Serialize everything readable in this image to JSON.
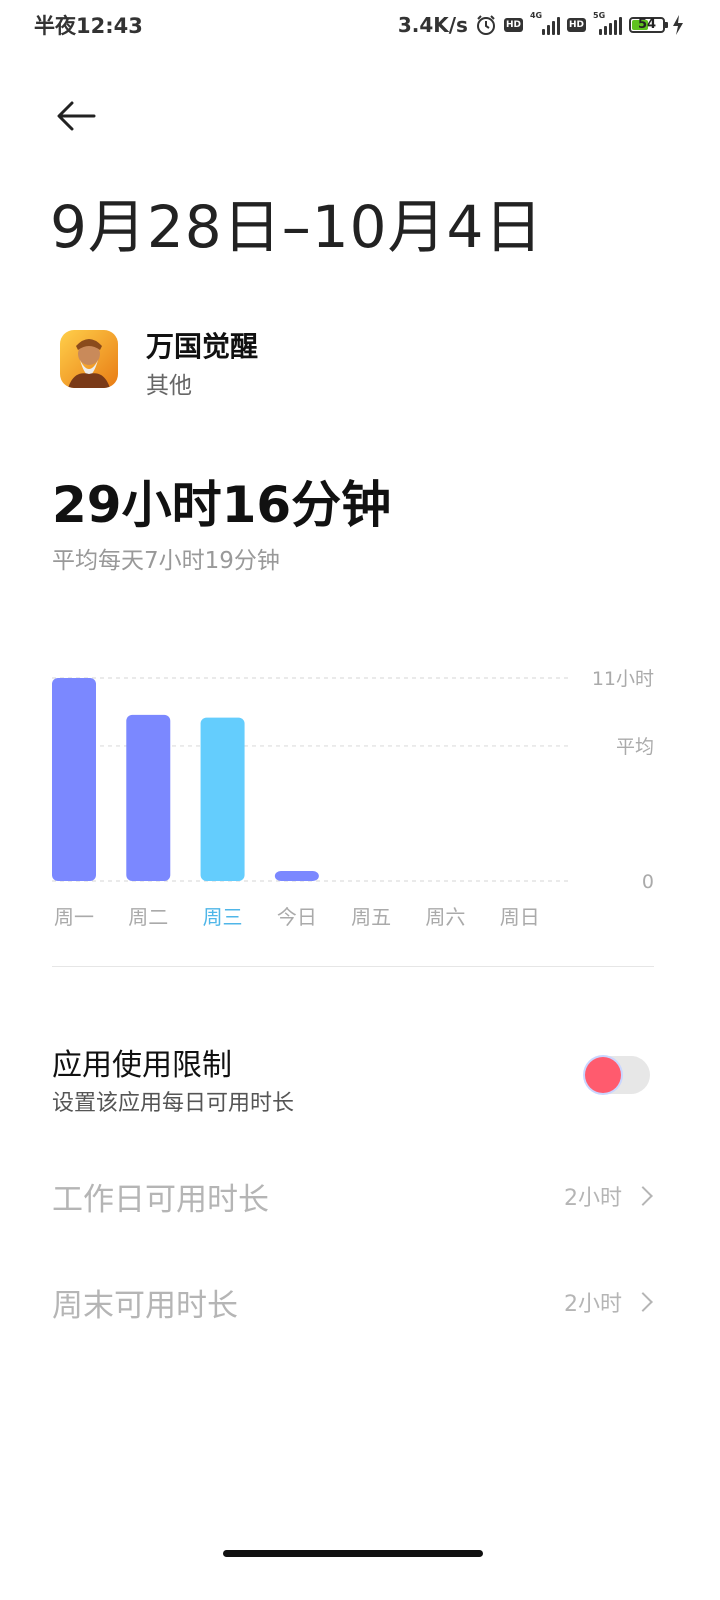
{
  "status_bar": {
    "time": "半夜12:43",
    "net_speed": "3.4K/s",
    "hd1": "HD",
    "net1": "4G",
    "hd2": "HD",
    "net2": "5G",
    "battery": "54",
    "battery_level": 0.54
  },
  "header": {
    "date_range": "9月28日–10月4日"
  },
  "app": {
    "name": "万国觉醒",
    "category": "其他"
  },
  "usage": {
    "total": "29小时16分钟",
    "average": "平均每天7小时19分钟"
  },
  "chart_data": {
    "type": "bar",
    "categories": [
      "周一",
      "周二",
      "周三",
      "今日",
      "周五",
      "周六",
      "周日"
    ],
    "values": [
      11.0,
      9.0,
      8.85,
      0.5,
      0,
      0,
      0
    ],
    "y_labels": {
      "max": "11小时",
      "avg": "平均",
      "zero": "0"
    },
    "ylim": [
      0,
      11
    ],
    "avg_value": 7.32,
    "highlight_index": 2,
    "colors": {
      "bar": "#7b88ff",
      "highlight": "#64cdfd",
      "highlight_label": "#4fb6e8",
      "label": "#aaaaaa",
      "grid": "#dddddd"
    }
  },
  "limit": {
    "title": "应用使用限制",
    "subtitle": "设置该应用每日可用时长",
    "enabled": false
  },
  "rows": {
    "weekday": {
      "label": "工作日可用时长",
      "value": "2小时"
    },
    "weekend": {
      "label": "周末可用时长",
      "value": "2小时"
    }
  },
  "icons": [
    "back-arrow-icon",
    "alarm-icon",
    "signal-icon",
    "battery-icon",
    "charging-icon",
    "chevron-right-icon"
  ]
}
